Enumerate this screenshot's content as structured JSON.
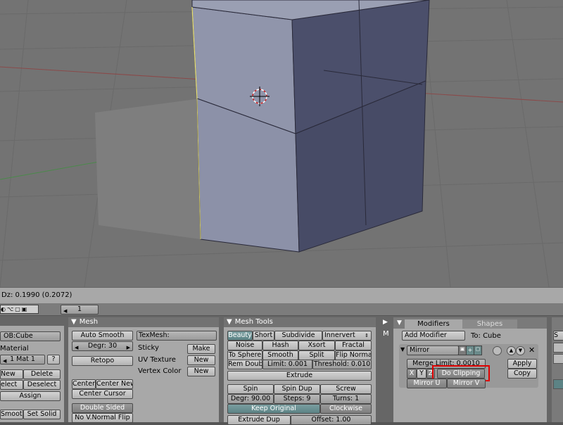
{
  "infobar": {
    "text": "Dz: 0.1990 (0.2072)"
  },
  "header": {
    "frame_value": "1"
  },
  "link_panel": {
    "object_name": "OB:Cube",
    "material_label": "Material",
    "material_slot": "1 Mat 1",
    "help": "?",
    "new": "New",
    "delete": "Delete",
    "select": "elect",
    "deselect": "Deselect",
    "assign": "Assign",
    "set_smooth": "Smooth",
    "set_solid": "Set Solid"
  },
  "mesh_panel": {
    "title": "Mesh",
    "auto_smooth": "Auto Smooth",
    "degr": "Degr: 30",
    "retopo": "Retopo",
    "texmesh": "TexMesh:",
    "sticky": "Sticky",
    "uv_texture": "UV Texture",
    "vertex_color": "Vertex Color",
    "make": "Make",
    "new1": "New",
    "new2": "New",
    "center": "Center",
    "center_new": "Center New",
    "center_cursor": "Center Cursor",
    "double_sided": "Double Sided",
    "no_vnormal_flip": "No V.Normal Flip"
  },
  "mesh_tools_panel": {
    "title": "Mesh Tools",
    "beauty": "Beauty",
    "short": "Short",
    "subdivide": "Subdivide",
    "innervert": "Innervert",
    "noise": "Noise",
    "hash": "Hash",
    "xsort": "Xsort",
    "fractal": "Fractal",
    "to_sphere": "To Sphere",
    "smooth": "Smooth",
    "split": "Split",
    "flip_normal": "Flip Normal",
    "rem_doubles": "Rem Doubl",
    "limit": "Limit: 0.001",
    "threshold": "Threshold: 0.010",
    "extrude": "Extrude",
    "spin": "Spin",
    "spin_dup": "Spin Dup",
    "screw": "Screw",
    "degr": "Degr: 90.00",
    "steps": "Steps: 9",
    "turns": "Turns: 1",
    "keep_original": "Keep Original",
    "clockwise": "Clockwise",
    "extrude_dup": "Extrude Dup",
    "offset": "Offset: 1.00"
  },
  "side_strip": {
    "arrow": "▶",
    "m": "M"
  },
  "modifiers_panel": {
    "tab_modifiers": "Modifiers",
    "tab_shapes": "Shapes",
    "add_modifier": "Add Modifier",
    "to_cube": "To: Cube",
    "mirror_name": "Mirror",
    "merge_limit": "Merge Limit: 0.0010",
    "x": "X",
    "y": "Y",
    "z": "Z",
    "do_clipping": "Do Clipping",
    "mirror_u": "Mirror U",
    "mirror_v": "Mirror V",
    "apply": "Apply",
    "copy": "Copy",
    "close": "✕"
  },
  "right_edge": {
    "s": "S"
  },
  "colors": {
    "viewport_bg": "#737373",
    "mesh_front": "#8a8fa5",
    "mesh_side": "#4a4e6a",
    "highlight": "#e00000"
  }
}
